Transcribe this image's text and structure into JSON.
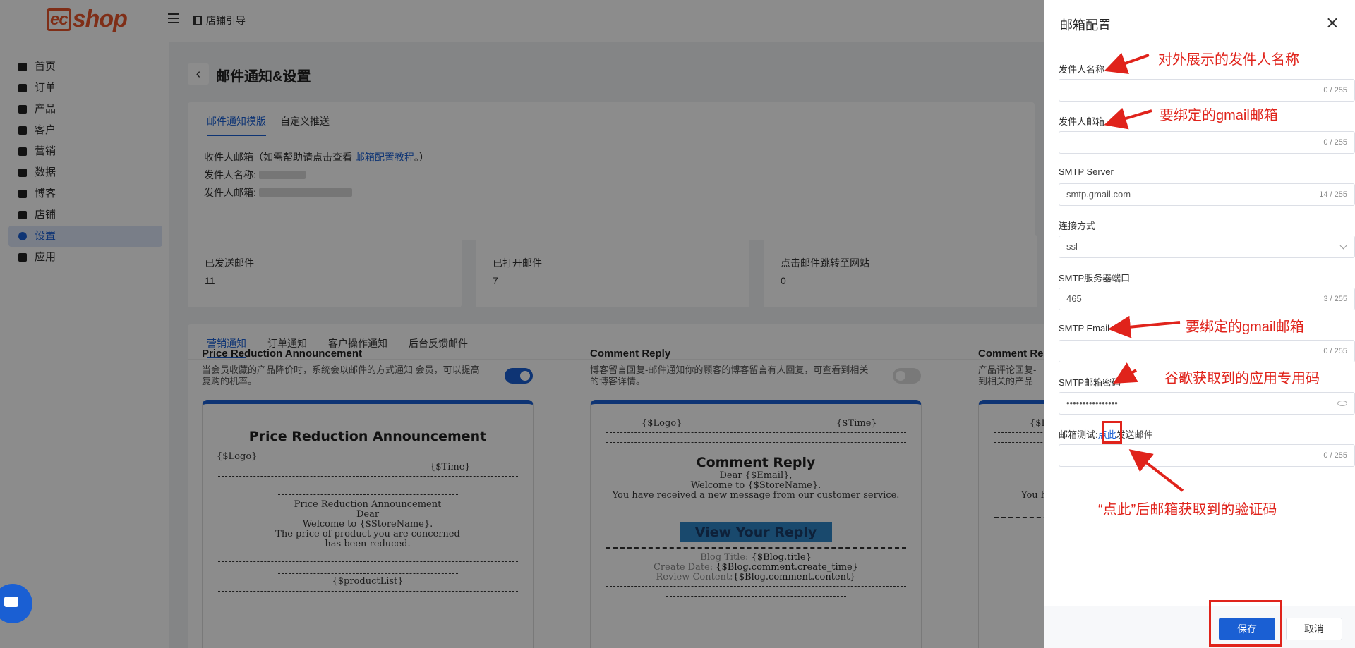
{
  "header": {
    "logo_prefix": "ec",
    "logo_text": "shop",
    "guide_label": "店铺引导"
  },
  "sidebar": {
    "items": [
      {
        "label": "首页",
        "icon": "home-icon"
      },
      {
        "label": "订单",
        "icon": "clipboard-icon"
      },
      {
        "label": "产品",
        "icon": "bag-icon"
      },
      {
        "label": "客户",
        "icon": "diamond-icon"
      },
      {
        "label": "营销",
        "icon": "tag-icon"
      },
      {
        "label": "数据",
        "icon": "bar-chart-icon"
      },
      {
        "label": "博客",
        "icon": "blog-icon"
      },
      {
        "label": "店铺",
        "icon": "store-icon"
      },
      {
        "label": "设置",
        "icon": "gear-icon",
        "active": true
      },
      {
        "label": "应用",
        "icon": "puzzle-icon"
      }
    ]
  },
  "page": {
    "back": "‹",
    "title": "邮件通知&设置",
    "tabs": [
      "邮件通知模版",
      "自定义推送"
    ],
    "info": {
      "recipient_prefix": "收件人邮箱（如需帮助请点击查看 ",
      "tutorial_link": "邮箱配置教程",
      "recipient_suffix": "。）",
      "sender_name_label": "发件人名称:",
      "sender_email_label": "发件人邮箱:"
    },
    "stats": [
      {
        "label": "已发送邮件",
        "value": "11"
      },
      {
        "label": "已打开邮件",
        "value": "7"
      },
      {
        "label": "点击邮件跳转至网站",
        "value": "0"
      }
    ],
    "notify_tabs": [
      "营销通知",
      "订单通知",
      "客户操作通知",
      "后台反馈邮件"
    ],
    "templates": [
      {
        "title": "Price Reduction Announcement",
        "desc": "当会员收藏的产品降价时，系统会以邮件的方式通知 会员，可以提高复购的机率。",
        "enabled": true,
        "preview": {
          "heading": "Price Reduction Announcement",
          "logo": "{$Logo}",
          "time": "{$Time}",
          "subtitle": "Price Reduction Announcement",
          "dear": "Dear",
          "welcome": "Welcome to {$StoreName}.",
          "line1": "The price of product you are concerned",
          "line2": "has been reduced.",
          "list": "{$productList}"
        }
      },
      {
        "title": "Comment Reply",
        "desc": "博客留言回复-邮件通知你的顾客的博客留言有人回复，可查看到相关的博客详情。",
        "enabled": false,
        "preview": {
          "logo": "{$Logo}",
          "time": "{$Time}",
          "heading": "Comment Reply",
          "dear": "Dear {$Email},",
          "welcome": "Welcome to {$StoreName}.",
          "message": "You have received a new message from our customer service.",
          "button": "View Your Reply",
          "blog_title_label": "Blog Title: ",
          "blog_title_value": "{$Blog.title}",
          "create_date_label": "Create Date: ",
          "create_date_value": "{$Blog.comment.create_time}",
          "review_label": "Review Content:",
          "review_value": "{$Blog.comment.content}"
        }
      },
      {
        "title": "Comment Re",
        "desc": "产品评论回复-",
        "desc2": "到相关的产品",
        "preview": {
          "logo": "{$Lo",
          "line": "You h"
        }
      }
    ]
  },
  "drawer": {
    "title": "邮箱配置",
    "close": "×",
    "fields": [
      {
        "label": "发件人名称",
        "value": "",
        "count": "0 / 255"
      },
      {
        "label": "发件人邮箱",
        "value": "",
        "count": "0 / 255"
      },
      {
        "label": "SMTP Server",
        "value": "smtp.gmail.com",
        "count": "14 / 255"
      },
      {
        "label": "连接方式",
        "value": "ssl"
      },
      {
        "label": "SMTP服务器端口",
        "value": "465",
        "count": "3 / 255"
      },
      {
        "label": "SMTP Email",
        "value": "",
        "count": "0 / 255"
      },
      {
        "label": "SMTP邮箱密码",
        "value": "••••••••••••••••"
      },
      {
        "label": "邮箱测试:",
        "link": "点此",
        "suffix": "发送邮件",
        "value": "",
        "count": "0 / 255"
      }
    ],
    "save": "保存",
    "cancel": "取消"
  },
  "annotations": {
    "sender_name": "对外展示的发件人名称",
    "sender_email": "要绑定的gmail邮箱",
    "smtp_email": "要绑定的gmail邮箱",
    "smtp_password": "谷歌获取到的应用专用码",
    "verify_code": "“点此”后邮箱获取到的验证码",
    "color": "#e0231b"
  },
  "colors": {
    "primary": "#1a5fd3",
    "logo": "#e8542b",
    "annotation": "#e0231b"
  }
}
